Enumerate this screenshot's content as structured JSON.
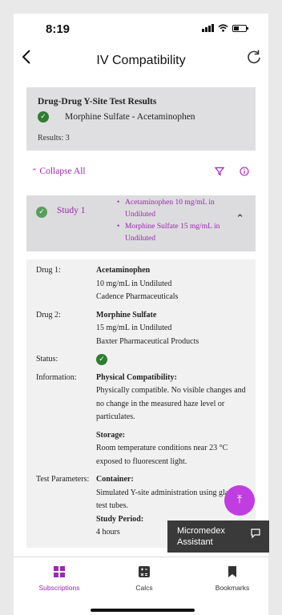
{
  "status": {
    "time": "8:19"
  },
  "nav": {
    "title": "IV Compatibility",
    "back_icon": "chevron-left-icon",
    "refresh_icon": "refresh-icon"
  },
  "results": {
    "title": "Drug-Drug Y-Site Test Results",
    "pair": "Morphine Sulfate - Acetaminophen",
    "count": "Results: 3"
  },
  "controls": {
    "collapse_all": "Collapse All",
    "filter_icon": "filter-icon",
    "info_icon": "info-icon"
  },
  "study": {
    "label": "Study 1",
    "drugs": [
      "Acetaminophen 10 mg/mL in Undiluted",
      "Morphine Sulfate 15 mg/mL in Undiluted"
    ]
  },
  "details": {
    "drug1_label": "Drug 1:",
    "drug1_name": "Acetaminophen",
    "drug1_conc": "10 mg/mL in Undiluted",
    "drug1_mfr": "Cadence Pharmaceuticals",
    "drug2_label": "Drug 2:",
    "drug2_name": "Morphine Sulfate",
    "drug2_conc": "15 mg/mL in Undiluted",
    "drug2_mfr": "Baxter Pharmaceutical Products",
    "status_label": "Status:",
    "info_label": "Information:",
    "phys_title": "Physical Compatibility:",
    "phys_text": "Physically compatible. No visible changes and no change in the measured haze level or particulates.",
    "storage_title": "Storage:",
    "storage_text": "Room temperature conditions near 23 °C exposed to fluorescent light.",
    "test_label": "Test Parameters:",
    "container_title": "Container:",
    "container_text": "Simulated Y-site administration using glass test tubes.",
    "study_period_title": "Study Period:",
    "study_period_text": "4 hours"
  },
  "assistant": {
    "label": "Micromedex Assistant"
  },
  "tabs": [
    {
      "label": "Subscriptions",
      "icon": "grid-icon",
      "color": "#9c27b0"
    },
    {
      "label": "Calcs",
      "icon": "calculator-icon",
      "color": "#333333"
    },
    {
      "label": "Bookmarks",
      "icon": "bookmark-icon",
      "color": "#333333"
    }
  ]
}
